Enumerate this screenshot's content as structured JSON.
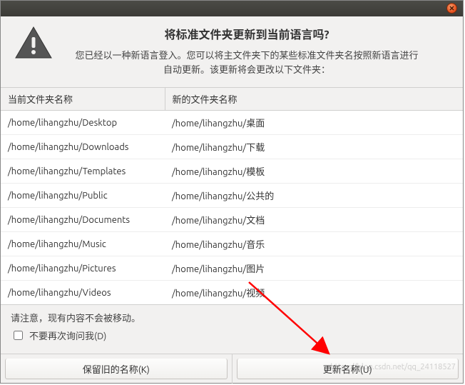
{
  "dialog": {
    "title": "将标准文件夹更新到当前语言吗?",
    "description": "您已经以一种新语言登入。您可以将主文件夹下的某些标准文件夹名按照新语言进行自动更新。该更新将会更改以下文件夹：",
    "note": "请注意，现有内容不会被移动。",
    "checkbox_label": "不要再次询问我(D)",
    "keep_button": "保留旧的名称(K)",
    "update_button": "更新名称(U)"
  },
  "table": {
    "headers": {
      "old": "当前文件夹名称",
      "new": "新的文件夹名称"
    },
    "rows": [
      {
        "old": "/home/lihangzhu/Desktop",
        "new": "/home/lihangzhu/桌面"
      },
      {
        "old": "/home/lihangzhu/Downloads",
        "new": "/home/lihangzhu/下载"
      },
      {
        "old": "/home/lihangzhu/Templates",
        "new": "/home/lihangzhu/模板"
      },
      {
        "old": "/home/lihangzhu/Public",
        "new": "/home/lihangzhu/公共的"
      },
      {
        "old": "/home/lihangzhu/Documents",
        "new": "/home/lihangzhu/文档"
      },
      {
        "old": "/home/lihangzhu/Music",
        "new": "/home/lihangzhu/音乐"
      },
      {
        "old": "/home/lihangzhu/Pictures",
        "new": "/home/lihangzhu/图片"
      },
      {
        "old": "/home/lihangzhu/Videos",
        "new": "/home/lihangzhu/视频"
      }
    ]
  },
  "watermark": "https://blog.csdn.net/qq_24118527"
}
